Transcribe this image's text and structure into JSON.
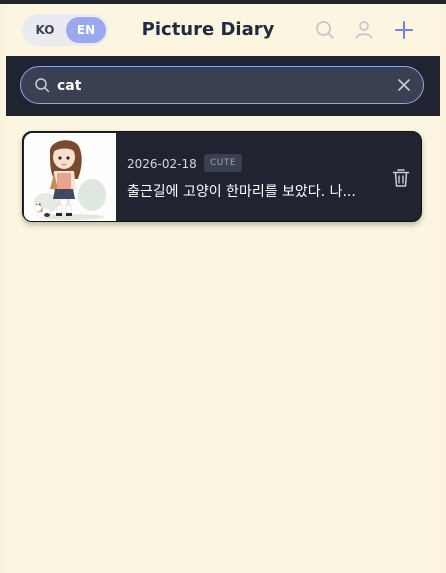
{
  "header": {
    "title": "Picture Diary",
    "lang_options": [
      "KO",
      "EN"
    ],
    "lang_selected": "EN",
    "icons": [
      "search-icon",
      "user-icon",
      "plus-icon"
    ]
  },
  "search": {
    "value": "cat",
    "placeholder": ""
  },
  "entries": [
    {
      "date": "2026-02-18",
      "tag": "CUTE",
      "text": "출근길에 고양이 한마리를 보았다. 나..."
    }
  ],
  "colors": {
    "background": "#fcf5e0",
    "dark": "#1f2430",
    "accent": "#9aa8f0",
    "search_border": "#8ea4ef"
  }
}
